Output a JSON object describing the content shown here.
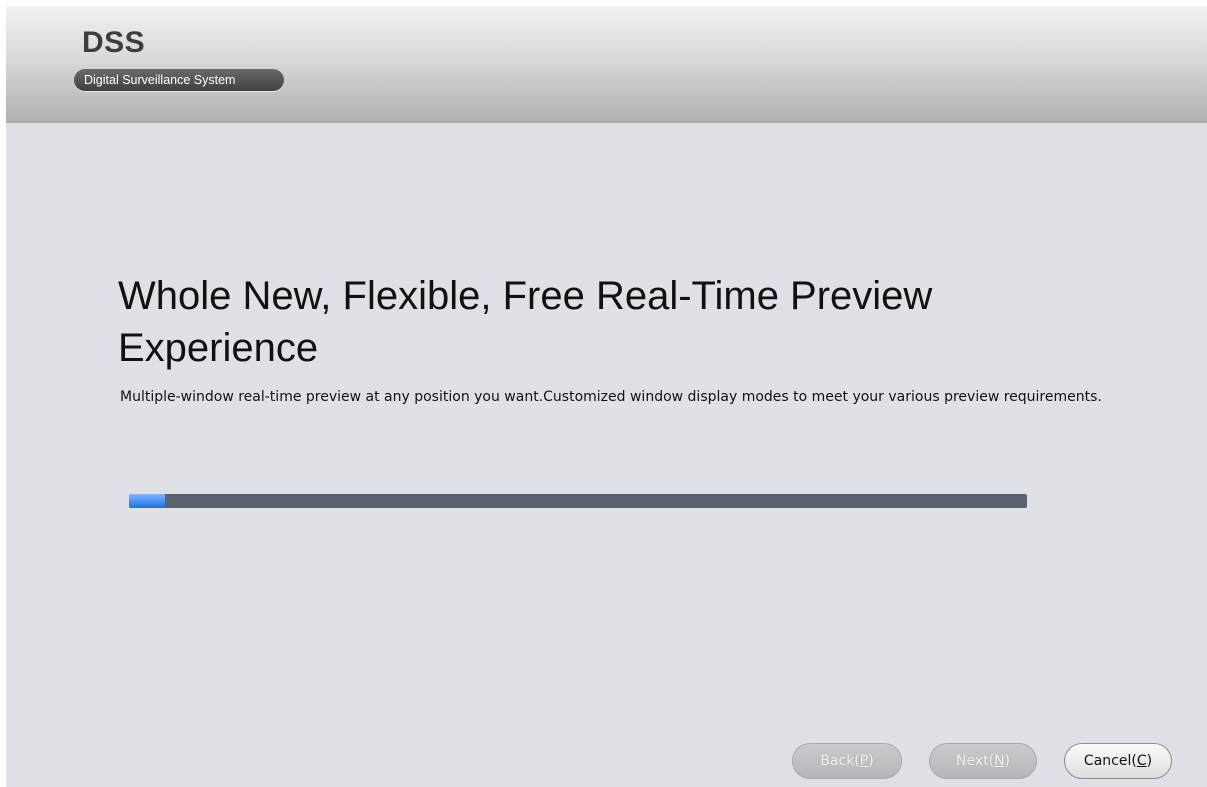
{
  "header": {
    "logo": "DSS",
    "subtitle": "Digital Surveillance System"
  },
  "main": {
    "headline": "Whole New, Flexible, Free Real-Time Preview Experience",
    "description": "Multiple-window real-time preview at any position you want.Customized window display modes to meet your various preview requirements."
  },
  "progress": {
    "value_fraction": 0.04
  },
  "buttons": {
    "back": {
      "label": "Back(",
      "mnemonic": "P",
      "suffix": ")",
      "enabled": false
    },
    "next": {
      "label": "Next(",
      "mnemonic": "N",
      "suffix": ")",
      "enabled": false
    },
    "cancel": {
      "label": "Cancel(",
      "mnemonic": "C",
      "suffix": ")",
      "enabled": true
    }
  },
  "colors": {
    "progress_fill": "#1f6fe0",
    "progress_track": "#5a6370",
    "background": "#dfe1e6"
  }
}
